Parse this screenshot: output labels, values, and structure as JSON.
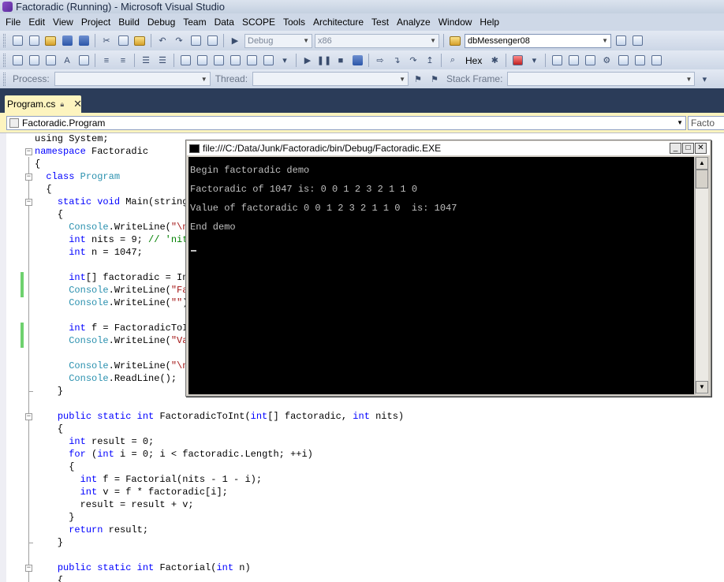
{
  "window": {
    "title": "Factoradic (Running) - Microsoft Visual Studio"
  },
  "menu": [
    "File",
    "Edit",
    "View",
    "Project",
    "Build",
    "Debug",
    "Team",
    "Data",
    "SCOPE",
    "Tools",
    "Architecture",
    "Test",
    "Analyze",
    "Window",
    "Help"
  ],
  "toolbar": {
    "config": "Debug",
    "platform": "x86",
    "find_combo": "dbMessenger08",
    "hex_label": "Hex",
    "process_label": "Process:",
    "thread_label": "Thread:",
    "stackframe_label": "Stack Frame:"
  },
  "tab": {
    "label": "Program.cs"
  },
  "navbar": {
    "type_combo": "Factoradic.Program",
    "member_combo": "Facto"
  },
  "code_lines": [
    [
      {
        "t": "using System;"
      }
    ],
    [
      {
        "t": "namespace ",
        "c": "kw"
      },
      {
        "t": "Factoradic"
      }
    ],
    [
      {
        "t": "{"
      }
    ],
    [
      {
        "t": "  "
      },
      {
        "t": "class ",
        "c": "kw"
      },
      {
        "t": "Program",
        "c": "ty"
      }
    ],
    [
      {
        "t": "  {"
      }
    ],
    [
      {
        "t": "    "
      },
      {
        "t": "static void ",
        "c": "kw"
      },
      {
        "t": "Main(string"
      }
    ],
    [
      {
        "t": "    {"
      }
    ],
    [
      {
        "t": "      "
      },
      {
        "t": "Console",
        "c": "ty"
      },
      {
        "t": ".WriteLine("
      },
      {
        "t": "\"\\n",
        "c": "str"
      }
    ],
    [
      {
        "t": "      "
      },
      {
        "t": "int ",
        "c": "kw"
      },
      {
        "t": "nits = 9; "
      },
      {
        "t": "// 'nit",
        "c": "cm"
      }
    ],
    [
      {
        "t": "      "
      },
      {
        "t": "int ",
        "c": "kw"
      },
      {
        "t": "n = 1047;"
      }
    ],
    [
      {
        "t": ""
      }
    ],
    [
      {
        "t": "      "
      },
      {
        "t": "int",
        "c": "kw"
      },
      {
        "t": "[] factoradic = In"
      }
    ],
    [
      {
        "t": "      "
      },
      {
        "t": "Console",
        "c": "ty"
      },
      {
        "t": ".WriteLine("
      },
      {
        "t": "\"Fa",
        "c": "str"
      }
    ],
    [
      {
        "t": "      "
      },
      {
        "t": "Console",
        "c": "ty"
      },
      {
        "t": ".WriteLine("
      },
      {
        "t": "\"\"",
        "c": "str"
      },
      {
        "t": ")"
      }
    ],
    [
      {
        "t": ""
      }
    ],
    [
      {
        "t": "      "
      },
      {
        "t": "int ",
        "c": "kw"
      },
      {
        "t": "f = FactoradicToI"
      }
    ],
    [
      {
        "t": "      "
      },
      {
        "t": "Console",
        "c": "ty"
      },
      {
        "t": ".WriteLine("
      },
      {
        "t": "\"Va",
        "c": "str"
      }
    ],
    [
      {
        "t": ""
      }
    ],
    [
      {
        "t": "      "
      },
      {
        "t": "Console",
        "c": "ty"
      },
      {
        "t": ".WriteLine("
      },
      {
        "t": "\"\\n",
        "c": "str"
      }
    ],
    [
      {
        "t": "      "
      },
      {
        "t": "Console",
        "c": "ty"
      },
      {
        "t": ".ReadLine();"
      }
    ],
    [
      {
        "t": "    }"
      }
    ],
    [
      {
        "t": ""
      }
    ],
    [
      {
        "t": "    "
      },
      {
        "t": "public static int ",
        "c": "kw"
      },
      {
        "t": "FactoradicToInt("
      },
      {
        "t": "int",
        "c": "kw"
      },
      {
        "t": "[] factoradic, "
      },
      {
        "t": "int ",
        "c": "kw"
      },
      {
        "t": "nits)"
      }
    ],
    [
      {
        "t": "    {"
      }
    ],
    [
      {
        "t": "      "
      },
      {
        "t": "int ",
        "c": "kw"
      },
      {
        "t": "result = 0;"
      }
    ],
    [
      {
        "t": "      "
      },
      {
        "t": "for ",
        "c": "kw"
      },
      {
        "t": "("
      },
      {
        "t": "int ",
        "c": "kw"
      },
      {
        "t": "i = 0; i < factoradic.Length; ++i)"
      }
    ],
    [
      {
        "t": "      {"
      }
    ],
    [
      {
        "t": "        "
      },
      {
        "t": "int ",
        "c": "kw"
      },
      {
        "t": "f = Factorial(nits - 1 - i);"
      }
    ],
    [
      {
        "t": "        "
      },
      {
        "t": "int ",
        "c": "kw"
      },
      {
        "t": "v = f * factoradic[i];"
      }
    ],
    [
      {
        "t": "        result = result + v;"
      }
    ],
    [
      {
        "t": "      }"
      }
    ],
    [
      {
        "t": "      "
      },
      {
        "t": "return ",
        "c": "kw"
      },
      {
        "t": "result;"
      }
    ],
    [
      {
        "t": "    }"
      }
    ],
    [
      {
        "t": ""
      }
    ],
    [
      {
        "t": "    "
      },
      {
        "t": "public static int ",
        "c": "kw"
      },
      {
        "t": "Factorial("
      },
      {
        "t": "int ",
        "c": "kw"
      },
      {
        "t": "n)"
      }
    ],
    [
      {
        "t": "    {"
      }
    ]
  ],
  "console": {
    "title": "file:///C:/Data/Junk/Factoradic/bin/Debug/Factoradic.EXE",
    "lines": [
      "Begin factoradic demo",
      "Factoradic of 1047 is: 0 0 1 2 3 2 1 1 0",
      "Value of factoradic 0 0 1 2 3 2 1 1 0  is: 1047",
      "End demo"
    ]
  }
}
